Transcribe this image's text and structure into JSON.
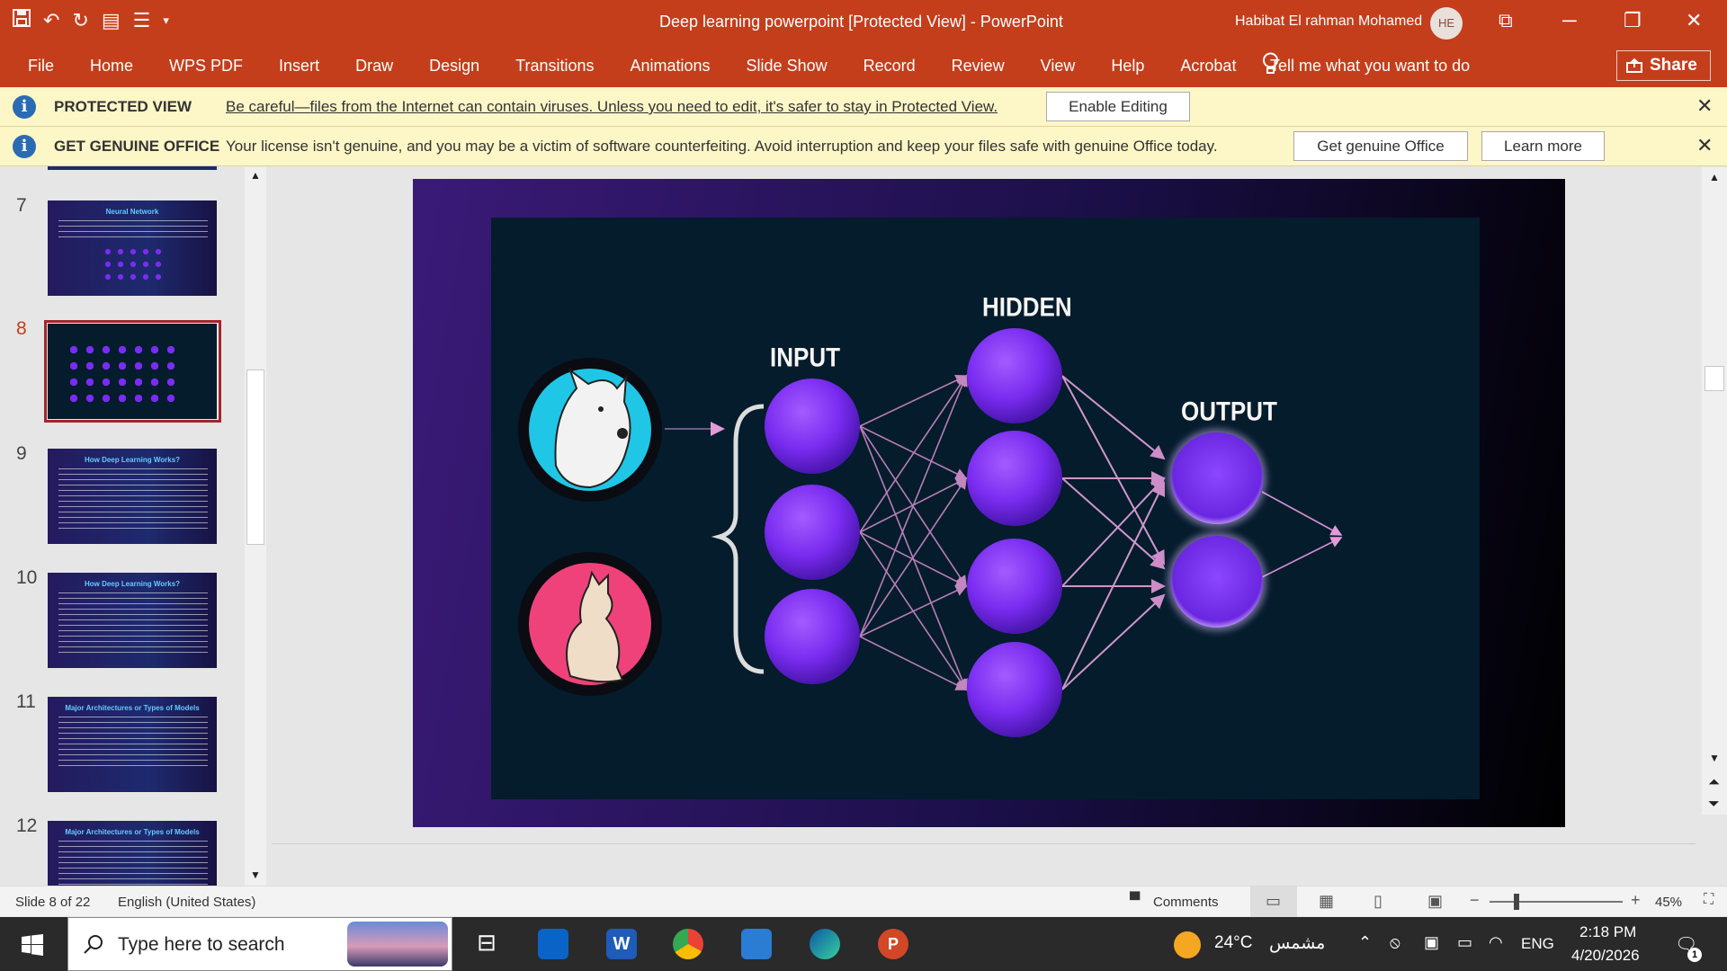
{
  "window": {
    "title": "Deep learning powerpoint [Protected View]  -  PowerPoint",
    "user": "Habibat El rahman Mohamed",
    "user_initials": "HE"
  },
  "ribbon": {
    "tabs": [
      "File",
      "Home",
      "WPS PDF",
      "Insert",
      "Draw",
      "Design",
      "Transitions",
      "Animations",
      "Slide Show",
      "Record",
      "Review",
      "View",
      "Help",
      "Acrobat"
    ],
    "tell_me": "Tell me what you want to do",
    "share": "Share"
  },
  "protected_bar": {
    "head": "PROTECTED VIEW",
    "message": "Be careful—files from the Internet can contain viruses. Unless you need to edit, it's safer to stay in Protected View.",
    "button": "Enable Editing"
  },
  "genuine_bar": {
    "head": "GET GENUINE OFFICE",
    "message": "Your license isn't genuine, and you may be a victim of software counterfeiting. Avoid interruption and keep your files safe with genuine Office today.",
    "button1": "Get genuine Office",
    "button2": "Learn more"
  },
  "thumbnails": [
    {
      "num": "7",
      "title": "Neural Network"
    },
    {
      "num": "8",
      "title": ""
    },
    {
      "num": "9",
      "title": "How Deep Learning Works?"
    },
    {
      "num": "10",
      "title": "How Deep Learning Works?"
    },
    {
      "num": "11",
      "title": "Major Architectures or Types of Models"
    },
    {
      "num": "12",
      "title": "Major Architectures or Types of Models"
    }
  ],
  "slide": {
    "label_input": "INPUT",
    "label_hidden": "HIDDEN",
    "label_output": "OUTPUT"
  },
  "status": {
    "slide": "Slide 8 of 22",
    "language": "English (United States)",
    "comments": "Comments",
    "zoom": "45%"
  },
  "taskbar": {
    "search": "Type here to search",
    "weather": "24°C",
    "weather_text": "مشمس",
    "lang": "ENG",
    "time": "2:18 PM",
    "date": "4/20/2026",
    "notifications": "1"
  },
  "colors": {
    "accent": "#c43e1c",
    "neuron": "#7a2cf0",
    "dog_bg": "#1fc6e6",
    "cat_bg": "#f0427a"
  }
}
